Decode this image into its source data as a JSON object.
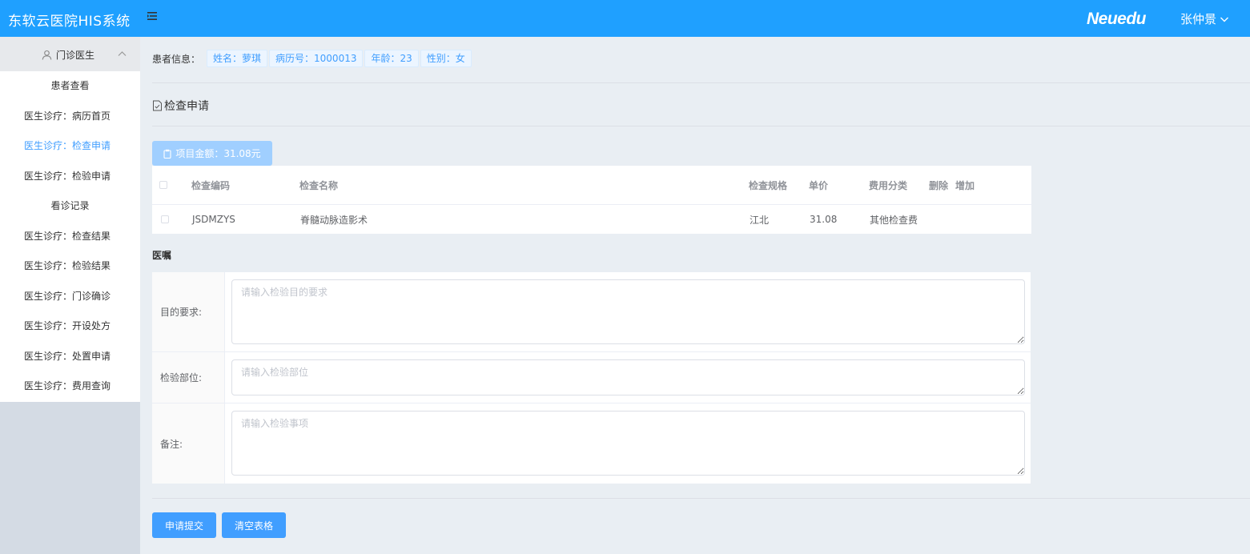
{
  "header": {
    "app_title": "东软云医院HIS系统",
    "brand": "Neuedu",
    "user_name": "张仲景"
  },
  "sidebar": {
    "group_title": "门诊医生",
    "items": [
      {
        "label": "患者查看",
        "active": false,
        "center": true
      },
      {
        "label": "医生诊疗：病历首页",
        "active": false
      },
      {
        "label": "医生诊疗：检查申请",
        "active": true
      },
      {
        "label": "医生诊疗：检验申请",
        "active": false
      },
      {
        "label": "看诊记录",
        "active": false,
        "center": true
      },
      {
        "label": "医生诊疗：检查结果",
        "active": false
      },
      {
        "label": "医生诊疗：检验结果",
        "active": false
      },
      {
        "label": "医生诊疗：门诊确诊",
        "active": false
      },
      {
        "label": "医生诊疗：开设处方",
        "active": false
      },
      {
        "label": "医生诊疗：处置申请",
        "active": false
      },
      {
        "label": "医生诊疗：费用查询",
        "active": false
      }
    ]
  },
  "patient": {
    "label": "患者信息：",
    "name": "姓名：萝琪",
    "record_no": "病历号：1000013",
    "age": "年龄：23",
    "gender": "性别：女"
  },
  "section_title": "检查申请",
  "amount_button": "项目金额：31.08元",
  "exam_table": {
    "headers": {
      "code": "检查编码",
      "name": "检查名称",
      "spec": "检查规格",
      "price": "单价",
      "fee_type": "费用分类",
      "delete": "删除",
      "add": "增加"
    },
    "rows": [
      {
        "code": "JSDMZYS",
        "name": "脊髓动脉造影术",
        "spec": "江北",
        "price": "31.08",
        "fee_type": "其他检查费"
      }
    ]
  },
  "advice": {
    "title": "医嘱",
    "purpose_label": "目的要求:",
    "purpose_placeholder": "请输入检验目的要求",
    "site_label": "检验部位:",
    "site_placeholder": "请输入检验部位",
    "notes_label": "备注:",
    "notes_placeholder": "请输入检验事项"
  },
  "buttons": {
    "submit": "申请提交",
    "clear": "清空表格"
  },
  "colors": {
    "header": "#1fa0ff",
    "primary": "#409eff",
    "amount_button": "#a0cfff"
  }
}
